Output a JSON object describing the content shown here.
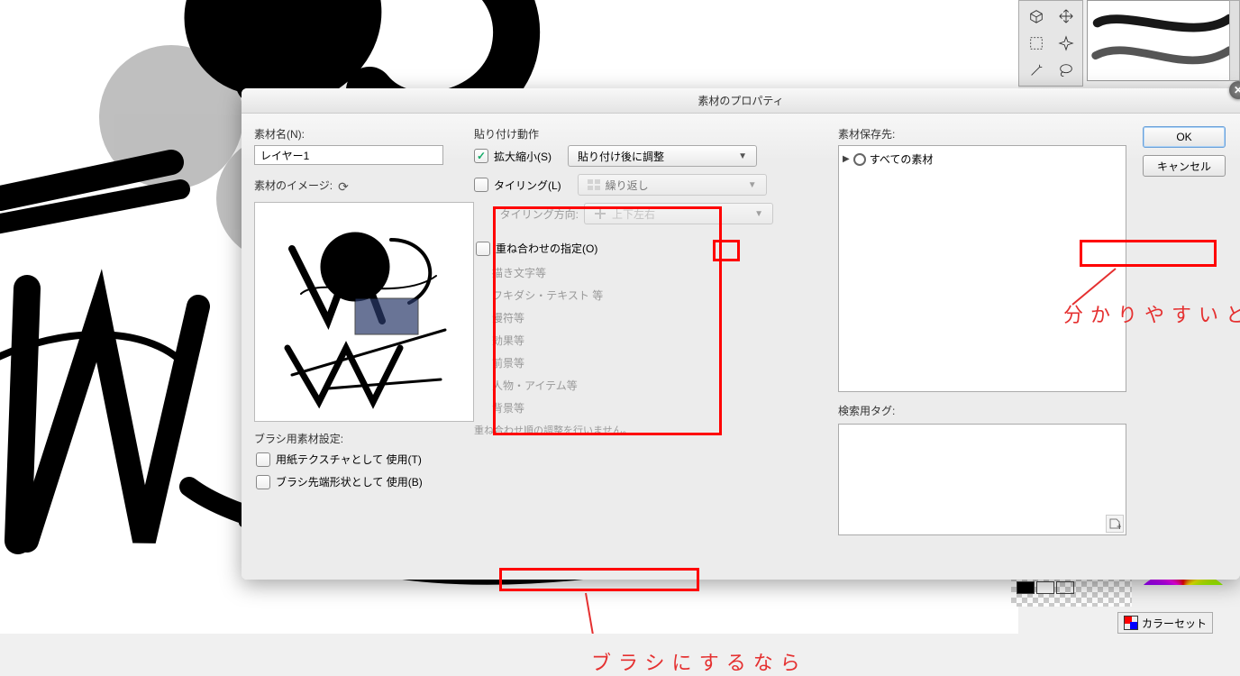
{
  "dialog": {
    "title": "素材のプロパティ",
    "name_label": "素材名(N):",
    "name_value": "レイヤー1",
    "image_label": "素材のイメージ:",
    "brush_section": "ブラシ用素材設定:",
    "use_as_texture": "用紙テクスチャとして 使用(T)",
    "use_as_tip": "ブラシ先端形状として 使用(B)",
    "paste_label": "貼り付け動作",
    "scale_label": "拡大縮小(S)",
    "paste_mode": "貼り付け後に調整",
    "tiling_label": "タイリング(L)",
    "tiling_mode": "繰り返し",
    "tiling_dir_label": "タイリング方向:",
    "tiling_dir_value": "上下左右",
    "overlap_label": "重ね合わせの指定(O)",
    "overlap_items": [
      "描き文字等",
      "フキダシ・テキスト 等",
      "漫符等",
      "効果等",
      "前景等",
      "人物・アイテム等",
      "背景等"
    ],
    "overlap_note": "重ね合わせ順の調整を行いません。",
    "dest_label": "素材保存先:",
    "dest_root": "すべての素材",
    "tag_label": "検索用タグ:",
    "ok": "OK",
    "cancel": "キャンセル"
  },
  "panels": {
    "color_set": "カラーセット"
  },
  "annotations": {
    "dest_hint": "分かりやすいところに",
    "tip_hint": "ブラシにするなら"
  }
}
